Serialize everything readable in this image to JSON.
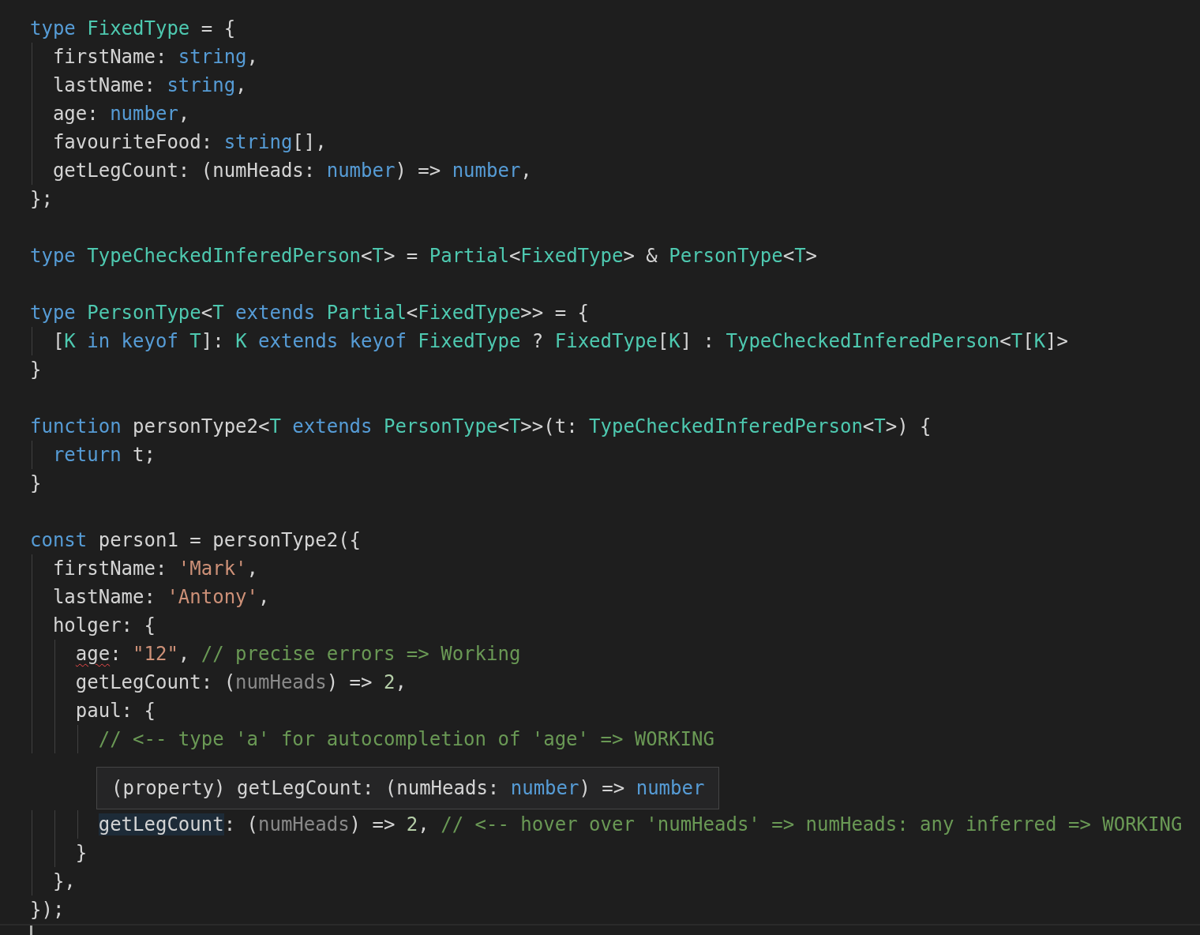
{
  "editor": {
    "lines": [
      {
        "kind": "code",
        "tokens": [
          {
            "text": "type ",
            "kind": "keyword"
          },
          {
            "text": "FixedType",
            "kind": "type"
          },
          {
            "text": " = {",
            "kind": "plain"
          }
        ]
      },
      {
        "kind": "code",
        "tokens": [
          {
            "text": "  firstName: ",
            "kind": "plain"
          },
          {
            "text": "string",
            "kind": "keyword"
          },
          {
            "text": ",",
            "kind": "plain"
          }
        ]
      },
      {
        "kind": "code",
        "tokens": [
          {
            "text": "  lastName: ",
            "kind": "plain"
          },
          {
            "text": "string",
            "kind": "keyword"
          },
          {
            "text": ",",
            "kind": "plain"
          }
        ]
      },
      {
        "kind": "code",
        "tokens": [
          {
            "text": "  age: ",
            "kind": "plain"
          },
          {
            "text": "number",
            "kind": "keyword"
          },
          {
            "text": ",",
            "kind": "plain"
          }
        ]
      },
      {
        "kind": "code",
        "tokens": [
          {
            "text": "  favouriteFood: ",
            "kind": "plain"
          },
          {
            "text": "string",
            "kind": "keyword"
          },
          {
            "text": "[],",
            "kind": "plain"
          }
        ]
      },
      {
        "kind": "code",
        "tokens": [
          {
            "text": "  getLegCount: (numHeads: ",
            "kind": "plain"
          },
          {
            "text": "number",
            "kind": "keyword"
          },
          {
            "text": ") => ",
            "kind": "plain"
          },
          {
            "text": "number",
            "kind": "keyword"
          },
          {
            "text": ",",
            "kind": "plain"
          }
        ]
      },
      {
        "kind": "code",
        "tokens": [
          {
            "text": "};",
            "kind": "plain"
          }
        ]
      },
      {
        "kind": "blank"
      },
      {
        "kind": "code",
        "tokens": [
          {
            "text": "type ",
            "kind": "keyword"
          },
          {
            "text": "TypeCheckedInferedPerson",
            "kind": "type"
          },
          {
            "text": "<",
            "kind": "plain"
          },
          {
            "text": "T",
            "kind": "type"
          },
          {
            "text": "> = ",
            "kind": "plain"
          },
          {
            "text": "Partial",
            "kind": "type"
          },
          {
            "text": "<",
            "kind": "plain"
          },
          {
            "text": "FixedType",
            "kind": "type"
          },
          {
            "text": "> & ",
            "kind": "plain"
          },
          {
            "text": "PersonType",
            "kind": "type"
          },
          {
            "text": "<",
            "kind": "plain"
          },
          {
            "text": "T",
            "kind": "type"
          },
          {
            "text": ">",
            "kind": "plain"
          }
        ]
      },
      {
        "kind": "blank"
      },
      {
        "kind": "code",
        "tokens": [
          {
            "text": "type ",
            "kind": "keyword"
          },
          {
            "text": "PersonType",
            "kind": "type"
          },
          {
            "text": "<",
            "kind": "plain"
          },
          {
            "text": "T",
            "kind": "type"
          },
          {
            "text": " extends ",
            "kind": "keyword"
          },
          {
            "text": "Partial",
            "kind": "type"
          },
          {
            "text": "<",
            "kind": "plain"
          },
          {
            "text": "FixedType",
            "kind": "type"
          },
          {
            "text": ">> = {",
            "kind": "plain"
          }
        ]
      },
      {
        "kind": "code",
        "tokens": [
          {
            "text": "  [",
            "kind": "plain"
          },
          {
            "text": "K",
            "kind": "type"
          },
          {
            "text": " in keyof ",
            "kind": "keyword"
          },
          {
            "text": "T",
            "kind": "type"
          },
          {
            "text": "]: ",
            "kind": "plain"
          },
          {
            "text": "K",
            "kind": "type"
          },
          {
            "text": " extends keyof ",
            "kind": "keyword"
          },
          {
            "text": "FixedType",
            "kind": "type"
          },
          {
            "text": " ? ",
            "kind": "plain"
          },
          {
            "text": "FixedType",
            "kind": "type"
          },
          {
            "text": "[",
            "kind": "plain"
          },
          {
            "text": "K",
            "kind": "type"
          },
          {
            "text": "] : ",
            "kind": "plain"
          },
          {
            "text": "TypeCheckedInferedPerson",
            "kind": "type"
          },
          {
            "text": "<",
            "kind": "plain"
          },
          {
            "text": "T",
            "kind": "type"
          },
          {
            "text": "[",
            "kind": "plain"
          },
          {
            "text": "K",
            "kind": "type"
          },
          {
            "text": "]>",
            "kind": "plain"
          }
        ]
      },
      {
        "kind": "code",
        "tokens": [
          {
            "text": "}",
            "kind": "plain"
          }
        ]
      },
      {
        "kind": "blank"
      },
      {
        "kind": "code",
        "tokens": [
          {
            "text": "function ",
            "kind": "keyword"
          },
          {
            "text": "personType2<",
            "kind": "plain"
          },
          {
            "text": "T",
            "kind": "type"
          },
          {
            "text": " extends ",
            "kind": "keyword"
          },
          {
            "text": "PersonType",
            "kind": "type"
          },
          {
            "text": "<",
            "kind": "plain"
          },
          {
            "text": "T",
            "kind": "type"
          },
          {
            "text": ">>(t: ",
            "kind": "plain"
          },
          {
            "text": "TypeCheckedInferedPerson",
            "kind": "type"
          },
          {
            "text": "<",
            "kind": "plain"
          },
          {
            "text": "T",
            "kind": "type"
          },
          {
            "text": ">) {",
            "kind": "plain"
          }
        ]
      },
      {
        "kind": "code",
        "tokens": [
          {
            "text": "  return",
            "kind": "keyword"
          },
          {
            "text": " t;",
            "kind": "plain"
          }
        ]
      },
      {
        "kind": "code",
        "tokens": [
          {
            "text": "}",
            "kind": "plain"
          }
        ]
      },
      {
        "kind": "blank"
      },
      {
        "kind": "code",
        "tokens": [
          {
            "text": "const ",
            "kind": "keyword"
          },
          {
            "text": "person1 = personType2({",
            "kind": "plain"
          }
        ]
      },
      {
        "kind": "code",
        "tokens": [
          {
            "text": "  firstName: ",
            "kind": "plain"
          },
          {
            "text": "'Mark'",
            "kind": "string"
          },
          {
            "text": ",",
            "kind": "plain"
          }
        ]
      },
      {
        "kind": "code",
        "tokens": [
          {
            "text": "  lastName: ",
            "kind": "plain"
          },
          {
            "text": "'Antony'",
            "kind": "string"
          },
          {
            "text": ",",
            "kind": "plain"
          }
        ]
      },
      {
        "kind": "code",
        "tokens": [
          {
            "text": "  holger: {",
            "kind": "plain"
          }
        ]
      },
      {
        "kind": "code",
        "tokens": [
          {
            "text": "    age",
            "kind": "error"
          },
          {
            "text": ": ",
            "kind": "plain"
          },
          {
            "text": "\"12\"",
            "kind": "string"
          },
          {
            "text": ", ",
            "kind": "plain"
          },
          {
            "text": "// precise errors => Working",
            "kind": "comment"
          }
        ]
      },
      {
        "kind": "code",
        "tokens": [
          {
            "text": "    getLegCount: (",
            "kind": "plain"
          },
          {
            "text": "numHeads",
            "kind": "unused"
          },
          {
            "text": ") => ",
            "kind": "plain"
          },
          {
            "text": "2",
            "kind": "number"
          },
          {
            "text": ",",
            "kind": "plain"
          }
        ]
      },
      {
        "kind": "code",
        "tokens": [
          {
            "text": "    paul: {",
            "kind": "plain"
          }
        ]
      },
      {
        "kind": "code",
        "tokens": [
          {
            "text": "      // <-- type 'a' for autocompletion of 'age' => WORKING",
            "kind": "comment"
          }
        ]
      },
      {
        "kind": "blank"
      },
      {
        "kind": "blank"
      },
      {
        "kind": "code",
        "tokens": [
          {
            "text": "      getLegCount",
            "kind": "hover"
          },
          {
            "text": ": (",
            "kind": "plain"
          },
          {
            "text": "numHeads",
            "kind": "unused"
          },
          {
            "text": ") => ",
            "kind": "plain"
          },
          {
            "text": "2",
            "kind": "number"
          },
          {
            "text": ", ",
            "kind": "plain"
          },
          {
            "text": "// <-- hover over 'numHeads' => numHeads: any inferred => WORKING",
            "kind": "comment"
          }
        ]
      },
      {
        "kind": "code",
        "tokens": [
          {
            "text": "    }",
            "kind": "plain"
          }
        ]
      },
      {
        "kind": "code",
        "tokens": [
          {
            "text": "  },",
            "kind": "plain"
          }
        ]
      },
      {
        "kind": "code",
        "tokens": [
          {
            "text": "});",
            "kind": "plain"
          }
        ]
      },
      {
        "kind": "current",
        "cursor": true
      }
    ],
    "tooltip": {
      "tokens": [
        {
          "text": "(property) getLegCount: (numHeads: ",
          "kind": "plain"
        },
        {
          "text": "number",
          "kind": "keyword"
        },
        {
          "text": ") => ",
          "kind": "plain"
        },
        {
          "text": "number",
          "kind": "keyword"
        }
      ]
    }
  }
}
